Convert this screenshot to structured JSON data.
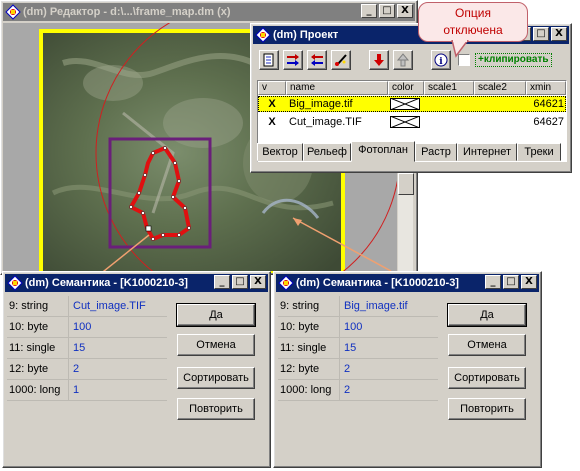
{
  "editor_window": {
    "title": "(dm) Редактор - d:\\...\\frame_map.dm (x)"
  },
  "project_window": {
    "title": "(dm) Проект",
    "clip_checkbox_label": "+клипировать",
    "columns": [
      "v",
      "name",
      "color",
      "scale1",
      "scale2",
      "xmin"
    ],
    "rows": [
      {
        "v": "X",
        "name": "Big_image.tif",
        "xmin": "64621"
      },
      {
        "v": "X",
        "name": "Cut_image.TIF",
        "xmin": "64627"
      }
    ],
    "tabs": [
      "Вектор",
      "Рельеф",
      "Фотоплан",
      "Растр",
      "Интернет",
      "Треки"
    ],
    "active_tab": "Фотоплан"
  },
  "callout": {
    "text_line1": "Опция",
    "text_line2": "отключена"
  },
  "semantic_left": {
    "title": "(dm) Семантика - [K1000210-3]",
    "rows": [
      {
        "key": "9: string",
        "value": "Cut_image.TIF"
      },
      {
        "key": "10: byte",
        "value": "100"
      },
      {
        "key": "11: single",
        "value": "15"
      },
      {
        "key": "12: byte",
        "value": "2"
      },
      {
        "key": "1000: long",
        "value": "1"
      }
    ],
    "buttons": {
      "ok": "Да",
      "cancel": "Отмена",
      "sort": "Сортировать",
      "repeat": "Повторить"
    }
  },
  "semantic_right": {
    "title": "(dm) Семантика - [K1000210-3]",
    "rows": [
      {
        "key": "9: string",
        "value": "Big_image.tif"
      },
      {
        "key": "10: byte",
        "value": "100"
      },
      {
        "key": "11: single",
        "value": "15"
      },
      {
        "key": "12: byte",
        "value": "2"
      },
      {
        "key": "1000: long",
        "value": "2"
      }
    ],
    "buttons": {
      "ok": "Да",
      "cancel": "Отмена",
      "sort": "Сортировать",
      "repeat": "Повторить"
    }
  },
  "title_buttons": {
    "minimize": "_",
    "maximize": "□",
    "close": "X"
  },
  "colors": {
    "title_active": "#0a246a",
    "title_inactive": "#808080",
    "face": "#d4d0c8",
    "selection": "#ffff00",
    "map_frame": "#ffff00",
    "clip_region": "#6a1f7a",
    "red_contour": "#e01010",
    "callout_border": "#c0606a",
    "value_text": "#1030c0"
  }
}
